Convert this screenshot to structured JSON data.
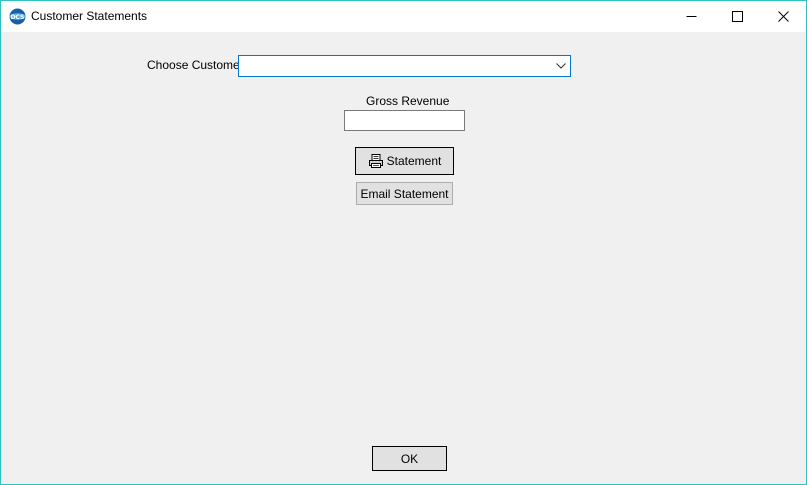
{
  "window": {
    "title": "Customer Statements"
  },
  "titlebar": {
    "minimize_icon": "minimize-icon",
    "maximize_icon": "maximize-icon",
    "close_icon": "close-icon"
  },
  "form": {
    "customer_label": "Choose Customer",
    "customer_value": "",
    "gross_revenue_label": "Gross Revenue",
    "gross_revenue_value": "",
    "statement_button": "Statement",
    "statement_icon": "printer-icon",
    "email_button": "Email Statement",
    "ok_button": "OK"
  },
  "colors": {
    "window_border": "#2ec2c2",
    "focus_border": "#0078d7",
    "background": "#f0f0f0"
  }
}
